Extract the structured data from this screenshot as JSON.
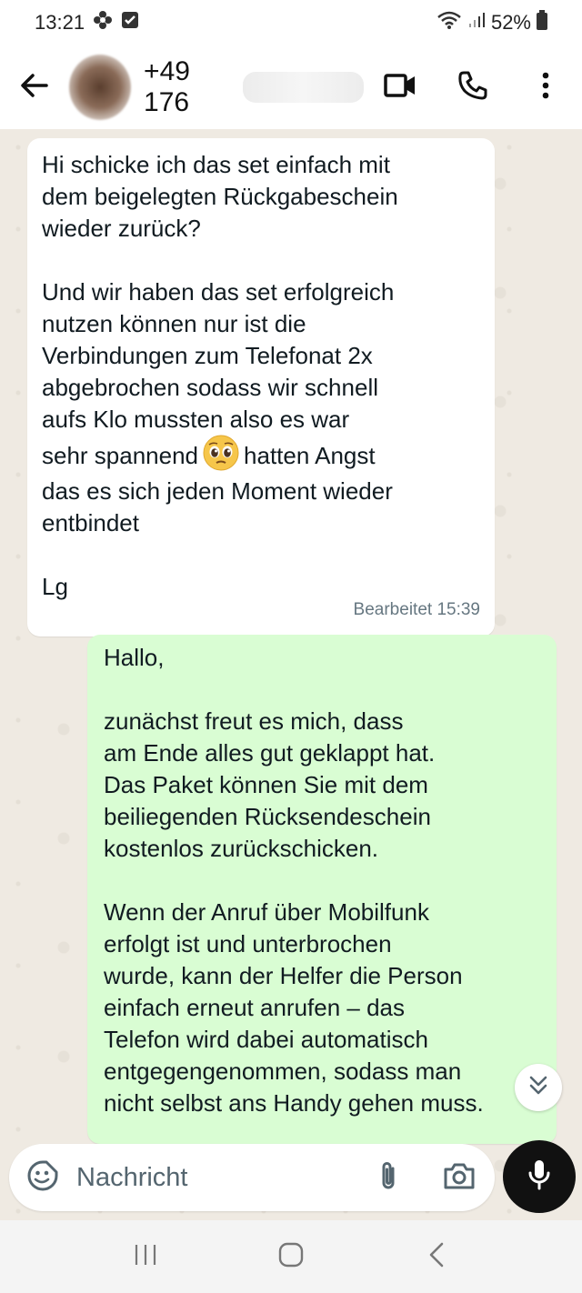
{
  "status_bar": {
    "time": "13:21",
    "battery": "52%",
    "icons": [
      "flower-icon",
      "check-box-icon",
      "wifi-icon",
      "signal-icon",
      "battery-icon"
    ]
  },
  "header": {
    "contact_name": "+49 176",
    "icons": [
      "back-arrow-icon",
      "video-call-icon",
      "phone-icon",
      "more-vertical-icon"
    ]
  },
  "messages": [
    {
      "direction": "incoming",
      "paragraph_1": "Hi schicke ich das set einfach mit\ndem beigelegten Rückgabeschein\nwieder zurück?",
      "paragraph_2_lines": [
        "Und wir haben das set erfolgreich",
        "nutzen können nur ist die",
        "Verbindungen zum Telefonat 2x",
        "abgebrochen sodass wir schnell",
        "aufs Klo mussten also es war"
      ],
      "emoji_line_before": "sehr spannend",
      "emoji": "pleading-face-emoji",
      "emoji_line_after": "hatten Angst",
      "paragraph_2_end": "das es sich jeden Moment wieder\nentbindet",
      "signoff": "Lg",
      "meta": "Bearbeitet 15:39"
    },
    {
      "direction": "outgoing",
      "greeting": "Hallo,",
      "paragraph_1": "zunächst freut es mich, dass\nam Ende alles gut geklappt hat.\nDas Paket können Sie mit dem\nbeiliegenden Rücksendeschein\nkostenlos zurückschicken.",
      "paragraph_2": "Wenn der Anruf über Mobilfunk\nerfolgt ist und unterbrochen\nwurde, kann der Helfer die Person\neinfach erneut anrufen – das\nTelefon wird dabei automatisch\nentgegengenommen, sodass man\nnicht selbst ans Handy gehen muss."
    }
  ],
  "composer": {
    "placeholder": "Nachricht",
    "icons": [
      "emoji-sticker-icon",
      "attachment-icon",
      "camera-icon",
      "microphone-icon"
    ]
  },
  "colors": {
    "incoming_bubble": "#ffffff",
    "outgoing_bubble": "#d9fdd3",
    "chat_background": "#efeae2",
    "mic_button": "#111111"
  }
}
